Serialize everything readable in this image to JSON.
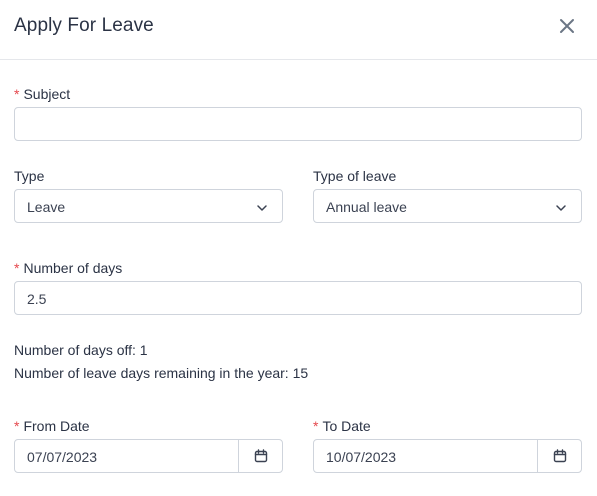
{
  "dialog": {
    "title": "Apply For Leave"
  },
  "subject": {
    "label": "Subject",
    "value": ""
  },
  "type": {
    "label": "Type",
    "value": "Leave"
  },
  "type_of_leave": {
    "label": "Type of leave",
    "value": "Annual leave"
  },
  "number_of_days": {
    "label": "Number of days",
    "value": "2.5"
  },
  "info": {
    "days_off": "Number of days off: 1",
    "remaining": "Number of leave days remaining in the year: 15"
  },
  "from_date": {
    "label": "From Date",
    "value": "07/07/2023"
  },
  "to_date": {
    "label": "To Date",
    "value": "10/07/2023"
  },
  "required_mark": "*",
  "colors": {
    "required": "#e5484d",
    "border": "#cfd4dc",
    "text": "#2b3345"
  }
}
